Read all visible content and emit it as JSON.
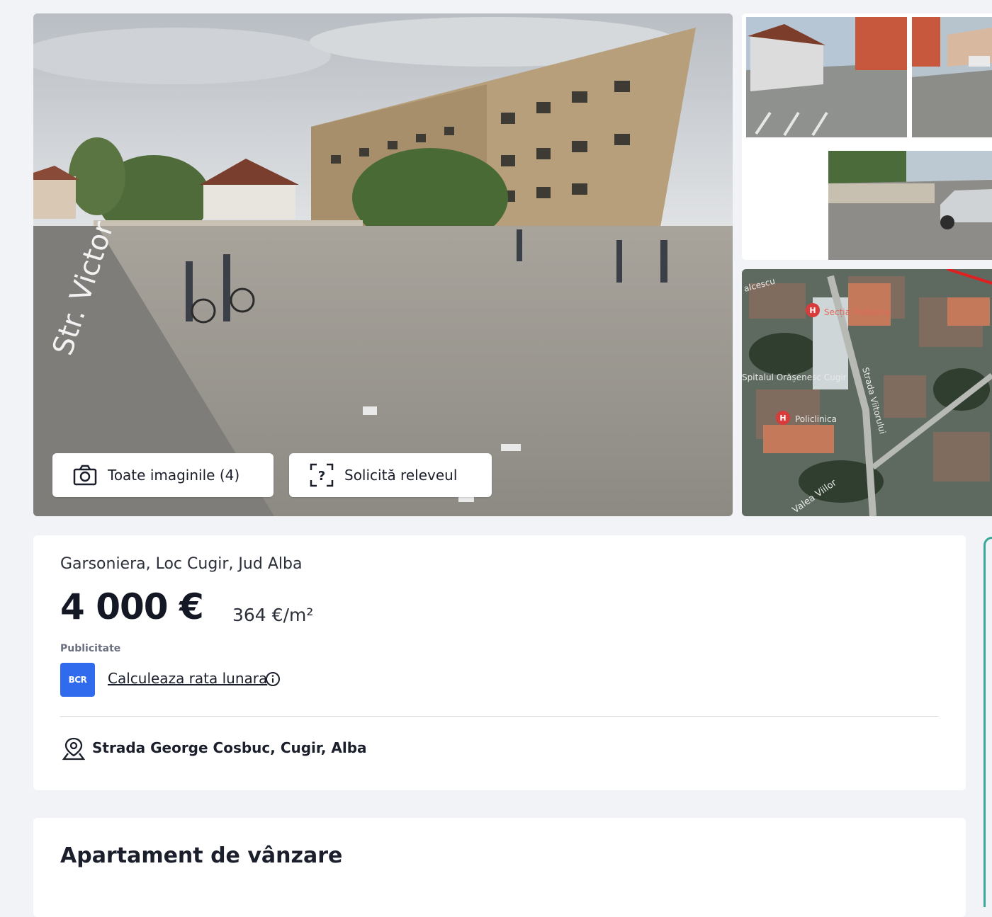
{
  "gallery": {
    "main_photo_alt": "Str. Victoriei",
    "all_images_label": "Toate imaginile (4)",
    "request_survey_label": "Solicită releveul",
    "map": {
      "labels": [
        "Secția Pediatrie",
        "Spitalul Orășenesc Cugir",
        "Policlinica",
        "Strada Viitorului",
        "Valea Viilor",
        "alcescu"
      ]
    }
  },
  "listing": {
    "title": "Garsoniera, Loc Cugir, Jud Alba",
    "price": "4 000 €",
    "price_per_sqm": "364 €/m²",
    "ad_label": "Publicitate",
    "bank_logo": "BCR",
    "calc_link": "Calculeaza rata lunara",
    "address": "Strada George Cosbuc, Cugir, Alba"
  },
  "description": {
    "title": "Apartament de vânzare"
  },
  "icons": {
    "camera": "camera-icon",
    "survey": "scan-question-icon",
    "info": "info-icon",
    "pin": "map-pin-icon"
  },
  "colors": {
    "accent": "#2f6bec",
    "page_bg": "#f2f3f6",
    "teal_edge": "#3aa79a"
  }
}
